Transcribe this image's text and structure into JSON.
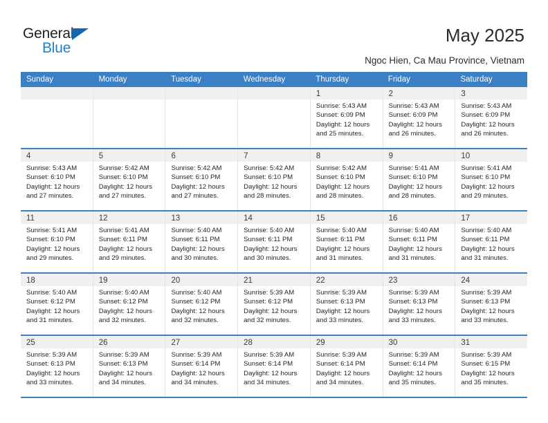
{
  "brand": {
    "name_part1": "General",
    "name_part2": "Blue",
    "triangle_icon": "triangle-icon",
    "accent_color": "#1f7fd0",
    "header_color": "#3b7fc4"
  },
  "header": {
    "title": "May 2025",
    "subtitle": "Ngoc Hien, Ca Mau Province, Vietnam"
  },
  "calendar": {
    "day_headers": [
      "Sunday",
      "Monday",
      "Tuesday",
      "Wednesday",
      "Thursday",
      "Friday",
      "Saturday"
    ],
    "weeks": [
      [
        {
          "day": "",
          "lines": []
        },
        {
          "day": "",
          "lines": []
        },
        {
          "day": "",
          "lines": []
        },
        {
          "day": "",
          "lines": []
        },
        {
          "day": "1",
          "lines": [
            "Sunrise: 5:43 AM",
            "Sunset: 6:09 PM",
            "Daylight: 12 hours",
            "and 25 minutes."
          ]
        },
        {
          "day": "2",
          "lines": [
            "Sunrise: 5:43 AM",
            "Sunset: 6:09 PM",
            "Daylight: 12 hours",
            "and 26 minutes."
          ]
        },
        {
          "day": "3",
          "lines": [
            "Sunrise: 5:43 AM",
            "Sunset: 6:09 PM",
            "Daylight: 12 hours",
            "and 26 minutes."
          ]
        }
      ],
      [
        {
          "day": "4",
          "lines": [
            "Sunrise: 5:43 AM",
            "Sunset: 6:10 PM",
            "Daylight: 12 hours",
            "and 27 minutes."
          ]
        },
        {
          "day": "5",
          "lines": [
            "Sunrise: 5:42 AM",
            "Sunset: 6:10 PM",
            "Daylight: 12 hours",
            "and 27 minutes."
          ]
        },
        {
          "day": "6",
          "lines": [
            "Sunrise: 5:42 AM",
            "Sunset: 6:10 PM",
            "Daylight: 12 hours",
            "and 27 minutes."
          ]
        },
        {
          "day": "7",
          "lines": [
            "Sunrise: 5:42 AM",
            "Sunset: 6:10 PM",
            "Daylight: 12 hours",
            "and 28 minutes."
          ]
        },
        {
          "day": "8",
          "lines": [
            "Sunrise: 5:42 AM",
            "Sunset: 6:10 PM",
            "Daylight: 12 hours",
            "and 28 minutes."
          ]
        },
        {
          "day": "9",
          "lines": [
            "Sunrise: 5:41 AM",
            "Sunset: 6:10 PM",
            "Daylight: 12 hours",
            "and 28 minutes."
          ]
        },
        {
          "day": "10",
          "lines": [
            "Sunrise: 5:41 AM",
            "Sunset: 6:10 PM",
            "Daylight: 12 hours",
            "and 29 minutes."
          ]
        }
      ],
      [
        {
          "day": "11",
          "lines": [
            "Sunrise: 5:41 AM",
            "Sunset: 6:10 PM",
            "Daylight: 12 hours",
            "and 29 minutes."
          ]
        },
        {
          "day": "12",
          "lines": [
            "Sunrise: 5:41 AM",
            "Sunset: 6:11 PM",
            "Daylight: 12 hours",
            "and 29 minutes."
          ]
        },
        {
          "day": "13",
          "lines": [
            "Sunrise: 5:40 AM",
            "Sunset: 6:11 PM",
            "Daylight: 12 hours",
            "and 30 minutes."
          ]
        },
        {
          "day": "14",
          "lines": [
            "Sunrise: 5:40 AM",
            "Sunset: 6:11 PM",
            "Daylight: 12 hours",
            "and 30 minutes."
          ]
        },
        {
          "day": "15",
          "lines": [
            "Sunrise: 5:40 AM",
            "Sunset: 6:11 PM",
            "Daylight: 12 hours",
            "and 31 minutes."
          ]
        },
        {
          "day": "16",
          "lines": [
            "Sunrise: 5:40 AM",
            "Sunset: 6:11 PM",
            "Daylight: 12 hours",
            "and 31 minutes."
          ]
        },
        {
          "day": "17",
          "lines": [
            "Sunrise: 5:40 AM",
            "Sunset: 6:11 PM",
            "Daylight: 12 hours",
            "and 31 minutes."
          ]
        }
      ],
      [
        {
          "day": "18",
          "lines": [
            "Sunrise: 5:40 AM",
            "Sunset: 6:12 PM",
            "Daylight: 12 hours",
            "and 31 minutes."
          ]
        },
        {
          "day": "19",
          "lines": [
            "Sunrise: 5:40 AM",
            "Sunset: 6:12 PM",
            "Daylight: 12 hours",
            "and 32 minutes."
          ]
        },
        {
          "day": "20",
          "lines": [
            "Sunrise: 5:40 AM",
            "Sunset: 6:12 PM",
            "Daylight: 12 hours",
            "and 32 minutes."
          ]
        },
        {
          "day": "21",
          "lines": [
            "Sunrise: 5:39 AM",
            "Sunset: 6:12 PM",
            "Daylight: 12 hours",
            "and 32 minutes."
          ]
        },
        {
          "day": "22",
          "lines": [
            "Sunrise: 5:39 AM",
            "Sunset: 6:13 PM",
            "Daylight: 12 hours",
            "and 33 minutes."
          ]
        },
        {
          "day": "23",
          "lines": [
            "Sunrise: 5:39 AM",
            "Sunset: 6:13 PM",
            "Daylight: 12 hours",
            "and 33 minutes."
          ]
        },
        {
          "day": "24",
          "lines": [
            "Sunrise: 5:39 AM",
            "Sunset: 6:13 PM",
            "Daylight: 12 hours",
            "and 33 minutes."
          ]
        }
      ],
      [
        {
          "day": "25",
          "lines": [
            "Sunrise: 5:39 AM",
            "Sunset: 6:13 PM",
            "Daylight: 12 hours",
            "and 33 minutes."
          ]
        },
        {
          "day": "26",
          "lines": [
            "Sunrise: 5:39 AM",
            "Sunset: 6:13 PM",
            "Daylight: 12 hours",
            "and 34 minutes."
          ]
        },
        {
          "day": "27",
          "lines": [
            "Sunrise: 5:39 AM",
            "Sunset: 6:14 PM",
            "Daylight: 12 hours",
            "and 34 minutes."
          ]
        },
        {
          "day": "28",
          "lines": [
            "Sunrise: 5:39 AM",
            "Sunset: 6:14 PM",
            "Daylight: 12 hours",
            "and 34 minutes."
          ]
        },
        {
          "day": "29",
          "lines": [
            "Sunrise: 5:39 AM",
            "Sunset: 6:14 PM",
            "Daylight: 12 hours",
            "and 34 minutes."
          ]
        },
        {
          "day": "30",
          "lines": [
            "Sunrise: 5:39 AM",
            "Sunset: 6:14 PM",
            "Daylight: 12 hours",
            "and 35 minutes."
          ]
        },
        {
          "day": "31",
          "lines": [
            "Sunrise: 5:39 AM",
            "Sunset: 6:15 PM",
            "Daylight: 12 hours",
            "and 35 minutes."
          ]
        }
      ]
    ]
  }
}
